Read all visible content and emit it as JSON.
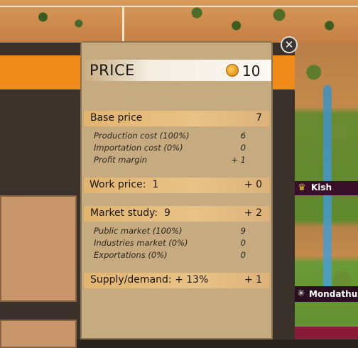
{
  "tooltip": {
    "title": "PRICE",
    "price_value": "10",
    "close_icon": "close-icon",
    "base_price": {
      "label": "Base price",
      "value": "7",
      "rows": [
        {
          "label": "Production cost (100%)",
          "value": "6"
        },
        {
          "label": "Importation cost (0%)",
          "value": "0"
        },
        {
          "label": "Profit margin",
          "value": "+ 1"
        }
      ]
    },
    "work_price": {
      "label": "Work price:  1",
      "value": "+ 0"
    },
    "market_study": {
      "label": "Market study:  9",
      "value": "+ 2",
      "rows": [
        {
          "label": "Public market (100%)",
          "value": "9"
        },
        {
          "label": "Industries market (0%)",
          "value": "0"
        },
        {
          "label": "Exportations (0%)",
          "value": "0"
        }
      ]
    },
    "supply_demand": {
      "label": "Supply/demand: + 13%",
      "value": "+ 1"
    }
  },
  "map": {
    "cities": [
      {
        "name": "Kish",
        "icon": "crown-icon"
      },
      {
        "name": "Mondathun",
        "icon": "star-icon"
      }
    ]
  },
  "colors": {
    "accent_orange": "#f08a18",
    "tooltip_bg": "#c7ab80",
    "band": "#e2b570"
  }
}
